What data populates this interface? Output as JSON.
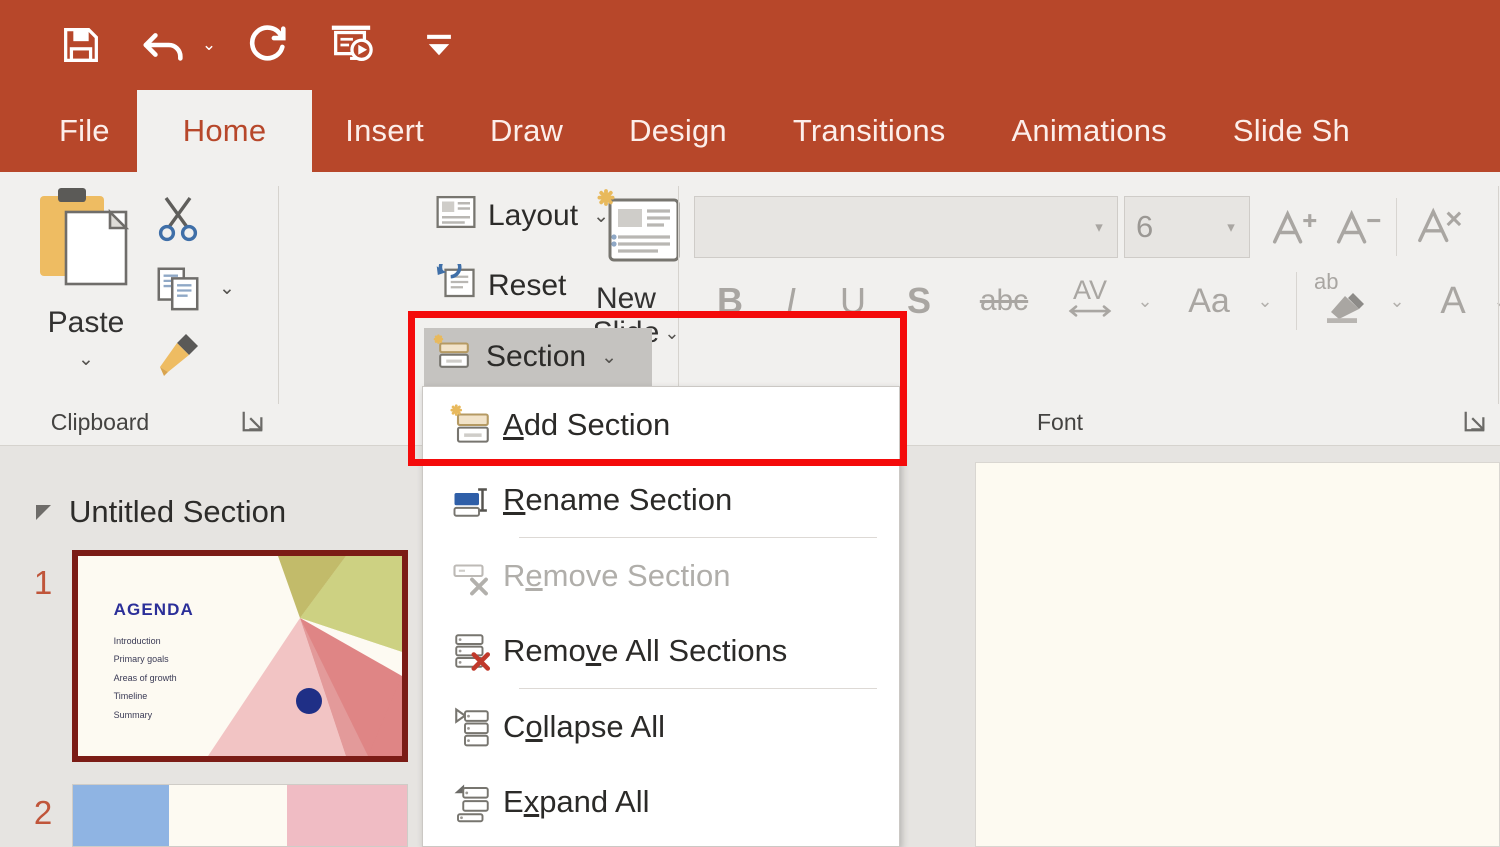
{
  "quick_access": {
    "items": [
      {
        "name": "save-icon",
        "label": "Save"
      },
      {
        "name": "undo-icon",
        "label": "Undo"
      },
      {
        "name": "undo-dropdown-caret",
        "label": "⌄"
      },
      {
        "name": "redo-icon",
        "label": "Redo"
      },
      {
        "name": "start-presentation-icon",
        "label": "Start From Beginning"
      },
      {
        "name": "customize-qat-caret",
        "label": "⌄"
      }
    ]
  },
  "ribbon_tabs": [
    {
      "label": "File",
      "active": false
    },
    {
      "label": "Home",
      "active": true
    },
    {
      "label": "Insert",
      "active": false
    },
    {
      "label": "Draw",
      "active": false
    },
    {
      "label": "Design",
      "active": false
    },
    {
      "label": "Transitions",
      "active": false
    },
    {
      "label": "Animations",
      "active": false
    },
    {
      "label": "Slide Sh",
      "active": false
    }
  ],
  "ribbon": {
    "clipboard": {
      "group_label": "Clipboard",
      "paste_label": "Paste",
      "paste_caret": "⌄",
      "cut_label": "Cut",
      "copy_label": "Copy",
      "copy_caret": "⌄",
      "format_painter_label": "Format Painter"
    },
    "slides": {
      "new_slide_line1": "New",
      "new_slide_line2": "Slide",
      "new_slide_caret": "⌄",
      "layout_label": "Layout",
      "layout_caret": "⌄",
      "reset_label": "Reset",
      "section_label": "Section",
      "section_caret": "⌄"
    },
    "font": {
      "group_label": "Font",
      "font_name_value": "",
      "font_name_placeholder": "",
      "font_size_value": "6",
      "bold_label": "B",
      "italic_label": "I",
      "underline_label": "U",
      "shadow_label": "S",
      "strikethrough_label": "abc",
      "char_spacing_label": "AV",
      "char_spacing_caret": "⌄",
      "change_case_label": "Aa",
      "change_case_caret": "⌄",
      "highlight_label": "ab",
      "highlight_caret": "⌄",
      "font_color_label": "A",
      "font_color_caret": "⌄"
    }
  },
  "section_menu": {
    "items": [
      {
        "label_pre": "",
        "label_key": "A",
        "label_post": "dd Section",
        "icon": "add-section-icon",
        "disabled": false,
        "separator_after": false
      },
      {
        "label_pre": "",
        "label_key": "R",
        "label_post": "ename Section",
        "icon": "rename-section-icon",
        "disabled": false,
        "separator_after": true
      },
      {
        "label_pre": "R",
        "label_key": "e",
        "label_post": "move Section",
        "icon": "remove-section-icon",
        "disabled": true,
        "separator_after": false
      },
      {
        "label_pre": "Remo",
        "label_key": "v",
        "label_post": "e All Sections",
        "icon": "remove-all-sections-icon",
        "disabled": false,
        "separator_after": true
      },
      {
        "label_pre": "C",
        "label_key": "o",
        "label_post": "llapse All",
        "icon": "collapse-all-icon",
        "disabled": false,
        "separator_after": false
      },
      {
        "label_pre": "E",
        "label_key": "x",
        "label_post": "pand All",
        "icon": "expand-all-icon",
        "disabled": false,
        "separator_after": false
      }
    ]
  },
  "slide_panel": {
    "section_name": "Untitled Section",
    "collapse_triangle": "▲",
    "slides": [
      {
        "number": "1",
        "selected": true,
        "title": "AGENDA",
        "bullets": [
          "Introduction",
          "Primary goals",
          "Areas of growth",
          "Timeline",
          "Summary"
        ]
      },
      {
        "number": "2",
        "selected": false,
        "title": "",
        "bullets": []
      }
    ]
  },
  "colors": {
    "ribbon_accent": "#b7472a",
    "ribbon_background": "#f1f0ee",
    "panel_background": "#e6e4e1",
    "slide_canvas": "#fdfaf1",
    "highlight_annotation": "#f40b0b",
    "selected_slide_border": "#7b1c16",
    "slide_number_color": "#c0553a",
    "agenda_title_color": "#2b2f99",
    "blue_dot_color": "#1f2f86"
  }
}
